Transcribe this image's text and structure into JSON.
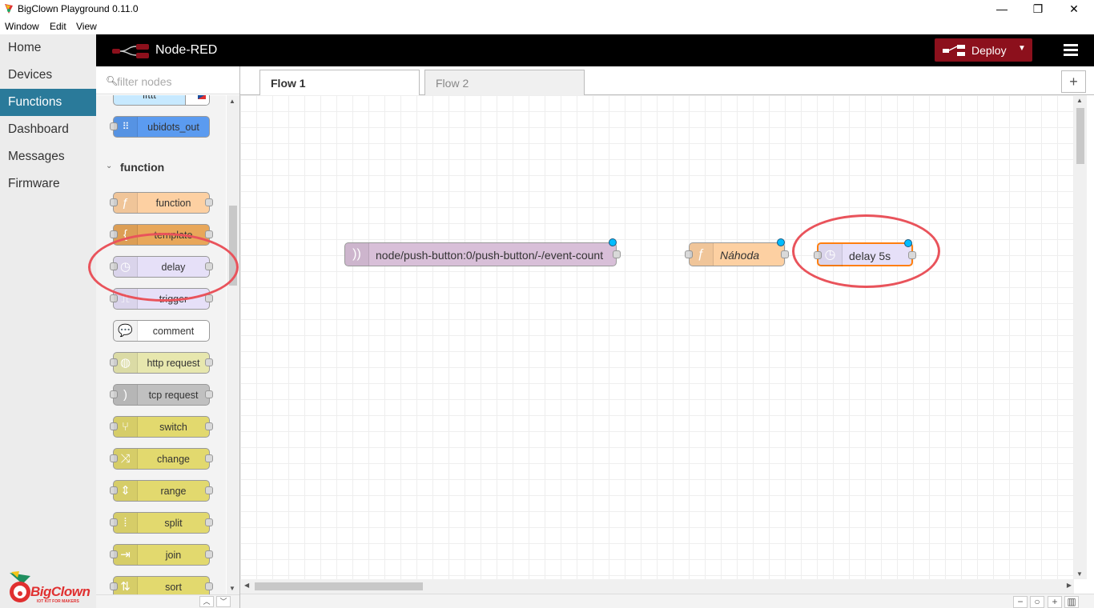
{
  "window": {
    "title": "BigClown Playground 0.11.0",
    "menu": [
      "Window",
      "Edit",
      "View"
    ],
    "controls": {
      "minimize": "—",
      "restore": "❐",
      "close": "✕"
    }
  },
  "app_nav": {
    "items": [
      {
        "label": "Home",
        "active": false
      },
      {
        "label": "Devices",
        "active": false
      },
      {
        "label": "Functions",
        "active": true
      },
      {
        "label": "Dashboard",
        "active": false
      },
      {
        "label": "Messages",
        "active": false
      },
      {
        "label": "Firmware",
        "active": false
      }
    ],
    "logo_text": "BigClown",
    "logo_tagline": "IOT KIT FOR MAKERS"
  },
  "header": {
    "brand": "Node-RED",
    "deploy_label": "Deploy",
    "accent": "#8c101c"
  },
  "palette": {
    "filter_placeholder": "filter nodes",
    "top_nodes": [
      {
        "label": "ifttt",
        "color": "#c7e9ff"
      },
      {
        "label": "ubidots_out",
        "color": "#5b9bf0"
      }
    ],
    "category": "function",
    "nodes": [
      {
        "label": "function",
        "color": "#fdd0a2",
        "icon": "function-icon",
        "glyph": "ƒ"
      },
      {
        "label": "template",
        "color": "#e8a75a",
        "icon": "template-icon",
        "glyph": "{"
      },
      {
        "label": "delay",
        "color": "#e6e0f8",
        "icon": "timer-icon",
        "glyph": "◷"
      },
      {
        "label": "trigger",
        "color": "#e6e0f8",
        "icon": "trigger-icon",
        "glyph": "⎍"
      },
      {
        "label": "comment",
        "color": "#ffffff",
        "icon": "comment-icon",
        "glyph": "💬"
      },
      {
        "label": "http request",
        "color": "#e7e7ae",
        "icon": "globe-icon",
        "glyph": "◍"
      },
      {
        "label": "tcp request",
        "color": "#c0c0c0",
        "icon": "bridge-icon",
        "glyph": ")"
      },
      {
        "label": "switch",
        "color": "#e2d96e",
        "icon": "switch-icon",
        "glyph": "⑂"
      },
      {
        "label": "change",
        "color": "#e2d96e",
        "icon": "shuffle-icon",
        "glyph": "⤨"
      },
      {
        "label": "range",
        "color": "#e2d96e",
        "icon": "range-icon",
        "glyph": "⇕"
      },
      {
        "label": "split",
        "color": "#e2d96e",
        "icon": "split-icon",
        "glyph": "⁞"
      },
      {
        "label": "join",
        "color": "#e2d96e",
        "icon": "join-icon",
        "glyph": "⇥"
      },
      {
        "label": "sort",
        "color": "#e2d96e",
        "icon": "sort-icon",
        "glyph": "⇅"
      }
    ]
  },
  "tabs": [
    {
      "label": "Flow 1",
      "active": true
    },
    {
      "label": "Flow 2",
      "active": false
    }
  ],
  "flow_nodes": [
    {
      "label": "node/push-button:0/push-button/-/event-count",
      "color": "#d8bfd8",
      "icon": "mqtt-icon",
      "glyph": "))",
      "italic": false
    },
    {
      "label": "Náhoda",
      "color": "#fdd0a2",
      "icon": "function-icon",
      "glyph": "ƒ",
      "italic": true
    },
    {
      "label": "delay 5s",
      "color": "#e6e0f8",
      "icon": "timer-icon",
      "glyph": "◷",
      "italic": false
    }
  ],
  "annotation_color": "#e9535b"
}
